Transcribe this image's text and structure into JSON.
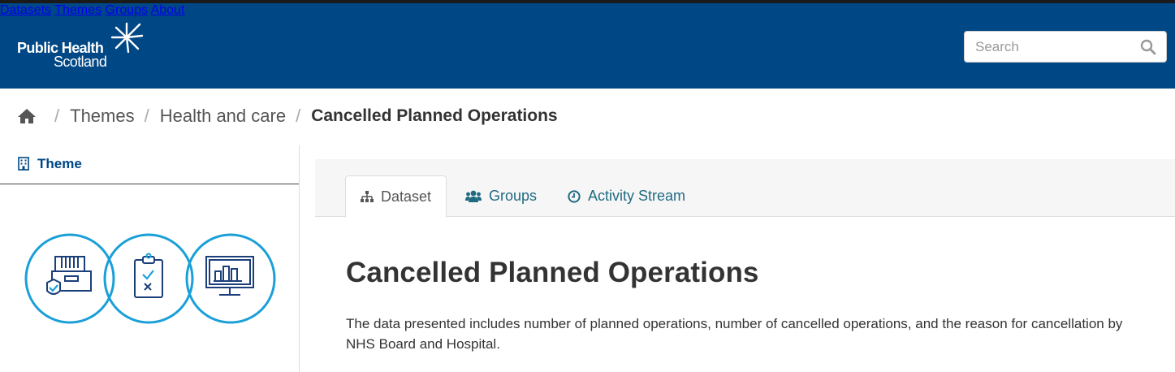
{
  "header": {
    "logo_line1": "Public Health",
    "logo_line2": "Scotland",
    "nav": [
      "Datasets",
      "Themes",
      "Groups",
      "About"
    ],
    "search_placeholder": "Search",
    "colors": {
      "masthead": "#004785",
      "link": "#206b82"
    }
  },
  "breadcrumb": {
    "home_icon": "home-icon",
    "items": [
      "Themes",
      "Health and care"
    ],
    "current": "Cancelled Planned Operations"
  },
  "sidebar": {
    "heading": "Theme",
    "heading_icon": "building-icon",
    "image_icons": [
      "secure-archive-icon",
      "clipboard-checklist-icon",
      "monitor-chart-icon"
    ]
  },
  "tabs": [
    {
      "label": "Dataset",
      "icon": "sitemap-icon",
      "active": true
    },
    {
      "label": "Groups",
      "icon": "users-icon",
      "active": false
    },
    {
      "label": "Activity Stream",
      "icon": "clock-icon",
      "active": false
    }
  ],
  "main": {
    "title": "Cancelled Planned Operations",
    "description": "The data presented includes number of planned operations, number of cancelled operations, and the reason for cancellation by NHS Board and Hospital."
  }
}
